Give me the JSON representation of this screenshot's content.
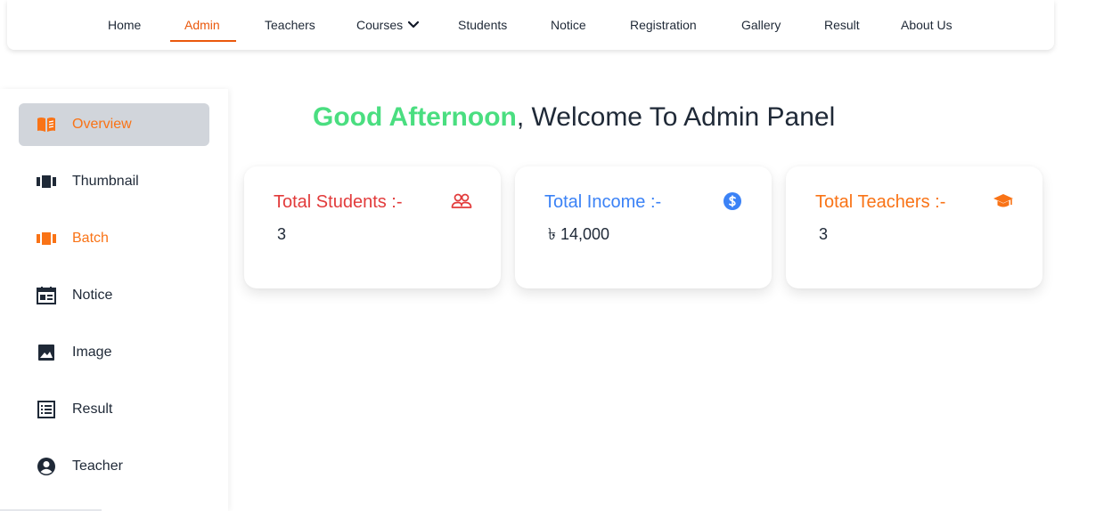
{
  "nav": {
    "items": [
      {
        "label": "Home"
      },
      {
        "label": "Admin"
      },
      {
        "label": "Teachers"
      },
      {
        "label": "Courses"
      },
      {
        "label": "Students"
      },
      {
        "label": "Notice"
      },
      {
        "label": "Registration"
      },
      {
        "label": "Gallery"
      },
      {
        "label": "Result"
      },
      {
        "label": "About Us"
      }
    ],
    "active": "Admin",
    "accent_color": "#ea580c"
  },
  "sidebar": {
    "items": [
      {
        "label": "Overview",
        "icon": "book-open-icon",
        "active": true
      },
      {
        "label": "Thumbnail",
        "icon": "carousel-icon"
      },
      {
        "label": "Batch",
        "icon": "carousel-icon"
      },
      {
        "label": "Notice",
        "icon": "calendar-icon"
      },
      {
        "label": "Image",
        "icon": "image-icon"
      },
      {
        "label": "Result",
        "icon": "list-icon"
      },
      {
        "label": "Teacher",
        "icon": "user-circle-icon"
      }
    ],
    "active_bg": "#d1d5db",
    "highlight_color": "#f97316"
  },
  "main": {
    "greeting_highlight": "Good Afternoon",
    "greeting_rest": ", Welcome To Admin Panel",
    "greeting_color": "#4ade80",
    "cards": [
      {
        "title": "Total Students :-",
        "value": "3",
        "icon": "users-icon",
        "color": "#e23b3b"
      },
      {
        "title": "Total Income :-",
        "value": "৳ 14,000",
        "icon": "dollar-coin-icon",
        "color": "#3b82f6"
      },
      {
        "title": "Total Teachers :-",
        "value": "3",
        "icon": "graduation-cap-icon",
        "color": "#f97316"
      }
    ]
  }
}
